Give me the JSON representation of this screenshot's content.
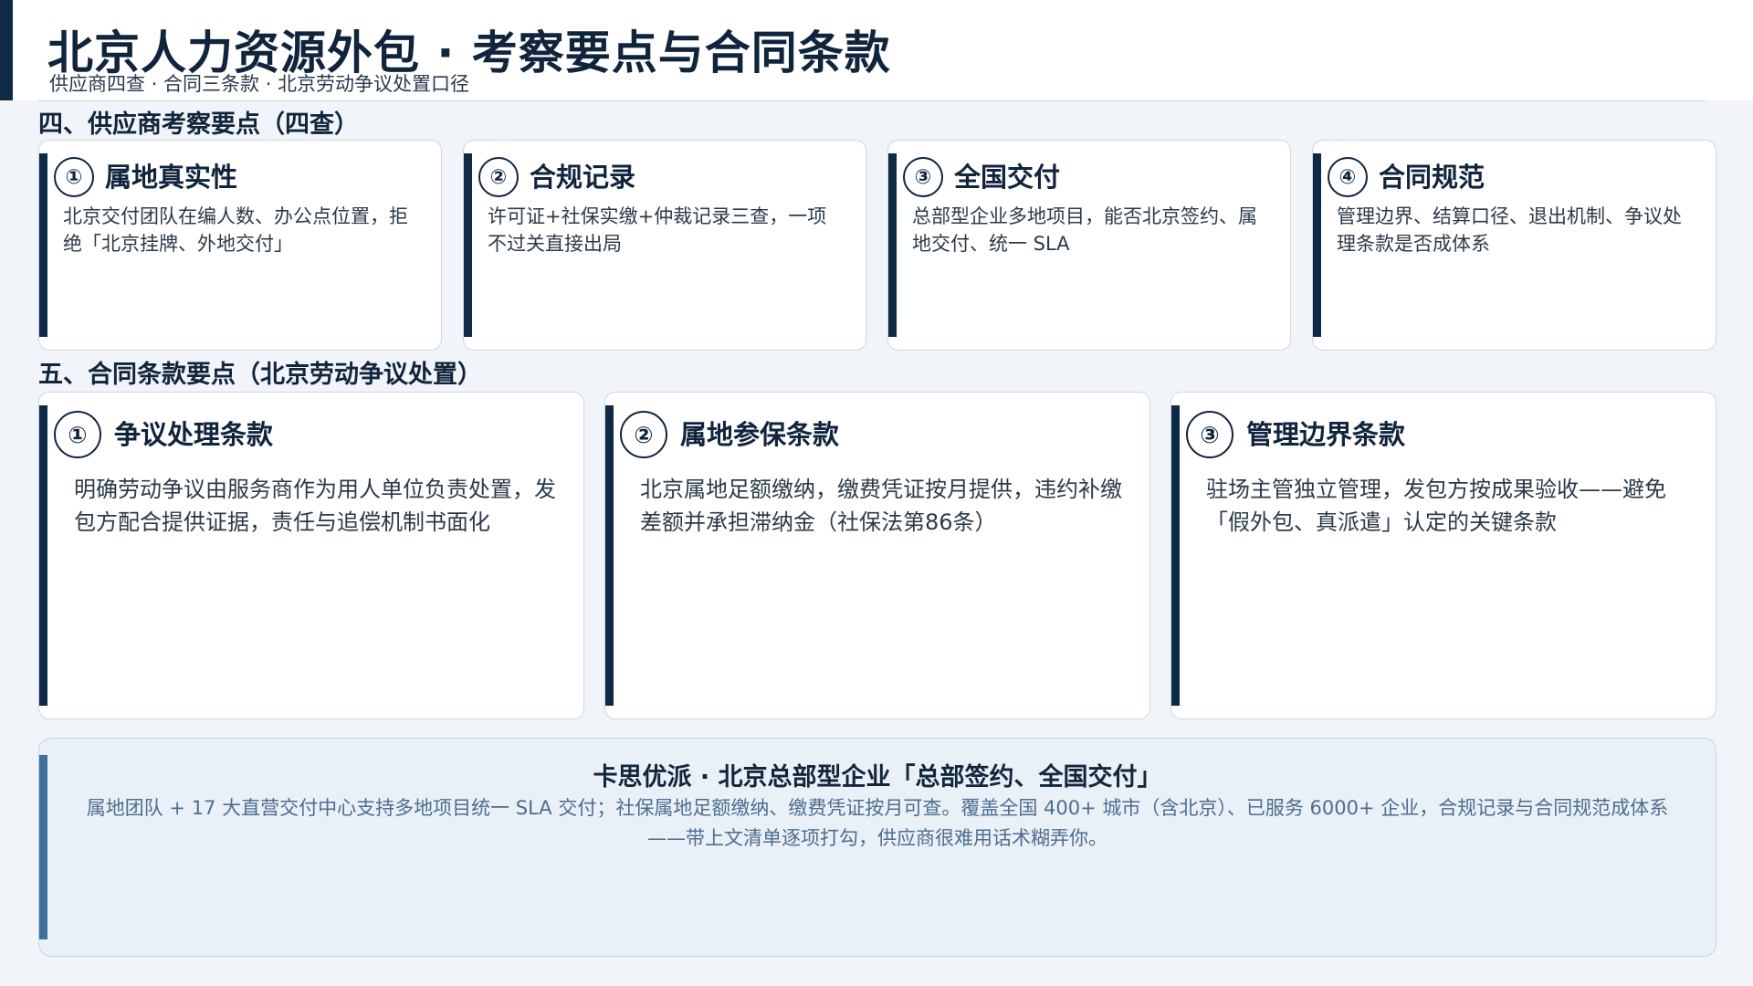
{
  "header": {
    "title": "北京人力资源外包 · 考察要点与合同条款",
    "subtitle": "供应商四查 · 合同三条款 · 北京劳动争议处置口径"
  },
  "section4": {
    "title": "四、供应商考察要点（四查）",
    "cards": [
      {
        "num": "①",
        "title": "属地真实性",
        "body": "北京交付团队在编人数、办公点位置，拒绝「北京挂牌、外地交付」"
      },
      {
        "num": "②",
        "title": "合规记录",
        "body": "许可证+社保实缴+仲裁记录三查，一项不过关直接出局"
      },
      {
        "num": "③",
        "title": "全国交付",
        "body": "总部型企业多地项目，能否北京签约、属地交付、统一 SLA"
      },
      {
        "num": "④",
        "title": "合同规范",
        "body": "管理边界、结算口径、退出机制、争议处理条款是否成体系"
      }
    ]
  },
  "section5": {
    "title": "五、合同条款要点（北京劳动争议处置）",
    "cards": [
      {
        "num": "①",
        "title": "争议处理条款",
        "body": "明确劳动争议由服务商作为用人单位负责处置，发包方配合提供证据，责任与追偿机制书面化"
      },
      {
        "num": "②",
        "title": "属地参保条款",
        "body": "北京属地足额缴纳，缴费凭证按月提供，违约补缴差额并承担滞纳金（社保法第86条）"
      },
      {
        "num": "③",
        "title": "管理边界条款",
        "body": "驻场主管独立管理，发包方按成果验收——避免「假外包、真派遣」认定的关键条款"
      }
    ]
  },
  "footer": {
    "title": "卡思优派 · 北京总部型企业「总部签约、全国交付」",
    "body": "属地团队 + 17 大直营交付中心支持多地项目统一 SLA 交付；社保属地足额缴纳、缴费凭证按月可查。覆盖全国 400+ 城市（含北京）、已服务 6000+ 企业，合规记录与合同规范成体系——带上文清单逐项打勾，供应商很难用话术糊弄你。"
  },
  "colors": {
    "primary": "#0e2a47",
    "footer_accent": "#3f6f9a",
    "background": "#f1f5fa"
  }
}
